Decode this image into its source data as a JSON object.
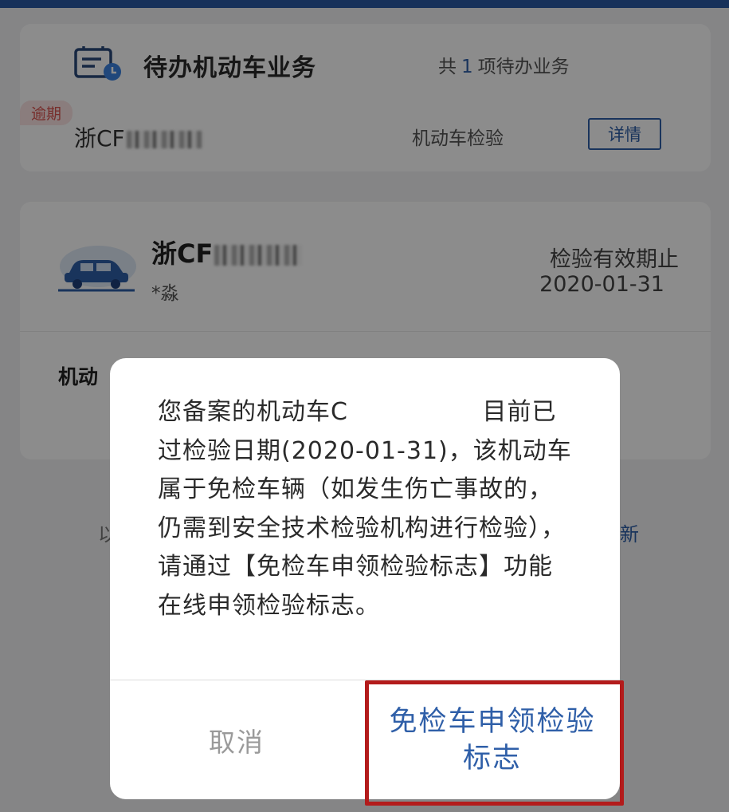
{
  "colors": {
    "accent": "#2f5fa8",
    "overdue": "#d9534f",
    "highlight": "#b31b1b"
  },
  "todo": {
    "title": "待办机动车业务",
    "count_prefix": "共",
    "count": "1",
    "count_suffix": "项待办业务",
    "badge": "逾期",
    "plate": "浙CF",
    "type": "机动车检验",
    "detail_button": "详情",
    "icon": "clipboard-clock-icon"
  },
  "vehicle": {
    "plate": "浙CF",
    "owner": "*淼",
    "expire_label": "检验有效期止",
    "expire_date": "2020-01-31",
    "section_title": "机动",
    "icon": "car-icon"
  },
  "background": {
    "left_fragment": "以",
    "right_fragment": "新"
  },
  "dialog": {
    "message": "您备案的机动车C                目前已过检验日期(2020-01-31)，该机动车属于免检车辆（如发生伤亡事故的，仍需到安全技术检验机构进行检验），请通过【免检车申领检验标志】功能在线申领检验标志。",
    "cancel": "取消",
    "confirm": "免检车申领检验标志"
  }
}
